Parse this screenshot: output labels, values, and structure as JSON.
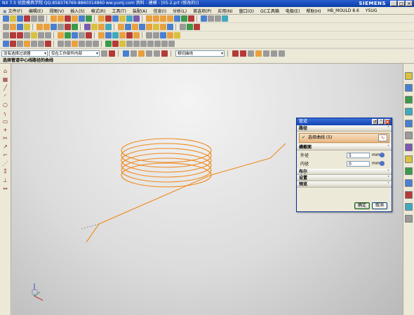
{
  "window": {
    "title": "NX 7.5 优胜模具学院 QQ:858376769-8860314860 ww.yumj.com 资料 - 建模 - [05-2.prt (修改的)]",
    "brand": "SIEMENS",
    "controls": [
      "_",
      "□",
      "×"
    ]
  },
  "menu": [
    "文件(F)",
    "编辑(E)",
    "视图(V)",
    "插入(S)",
    "格式(R)",
    "工具(T)",
    "装配(A)",
    "信息(I)",
    "分析(L)",
    "首选项(P)",
    "应用(N)",
    "窗口(O)",
    "GC工具箱",
    "电极(E)",
    "帮助(H)",
    "HB_MOULD 8.6",
    "YSUG"
  ],
  "filter": {
    "type_filter": "没有选择过滤器",
    "scope": "仅在工作部件内部",
    "snap_filter": "相切曲线"
  },
  "cue": "选择管道中心线路径的曲线",
  "dialog": {
    "title": "管道",
    "path_group": "路径",
    "selected_curves": "选择曲线 (5)",
    "section_group": "横截面",
    "outer_diameter_label": "外径",
    "outer_diameter_value": "5",
    "outer_diameter_unit": "mm",
    "inner_diameter_label": "内径",
    "inner_diameter_value": "0",
    "inner_diameter_unit": "mm",
    "boolean_group": "布尔",
    "settings_group": "设置",
    "preview_group": "预览",
    "ok_label": "确定",
    "cancel_label": "取消"
  },
  "colors": {
    "curve": "#f08a1e",
    "title_blue": "#1444b4",
    "selection_fill": "#eab885"
  },
  "icons": {
    "left_toolbar": [
      "wcs-icon",
      "sketch-icon",
      "line-icon",
      "arc-icon",
      "circle-icon",
      "fillet-icon",
      "rectangle-icon",
      "point-icon",
      "trim-icon"
    ],
    "right_toolbar": [
      "assembly-navigator-icon",
      "part-navigator-icon",
      "history-icon",
      "reuse-library-icon",
      "web-browser-icon",
      "roles-icon",
      "system-materials-icon",
      "palette-icon"
    ]
  }
}
